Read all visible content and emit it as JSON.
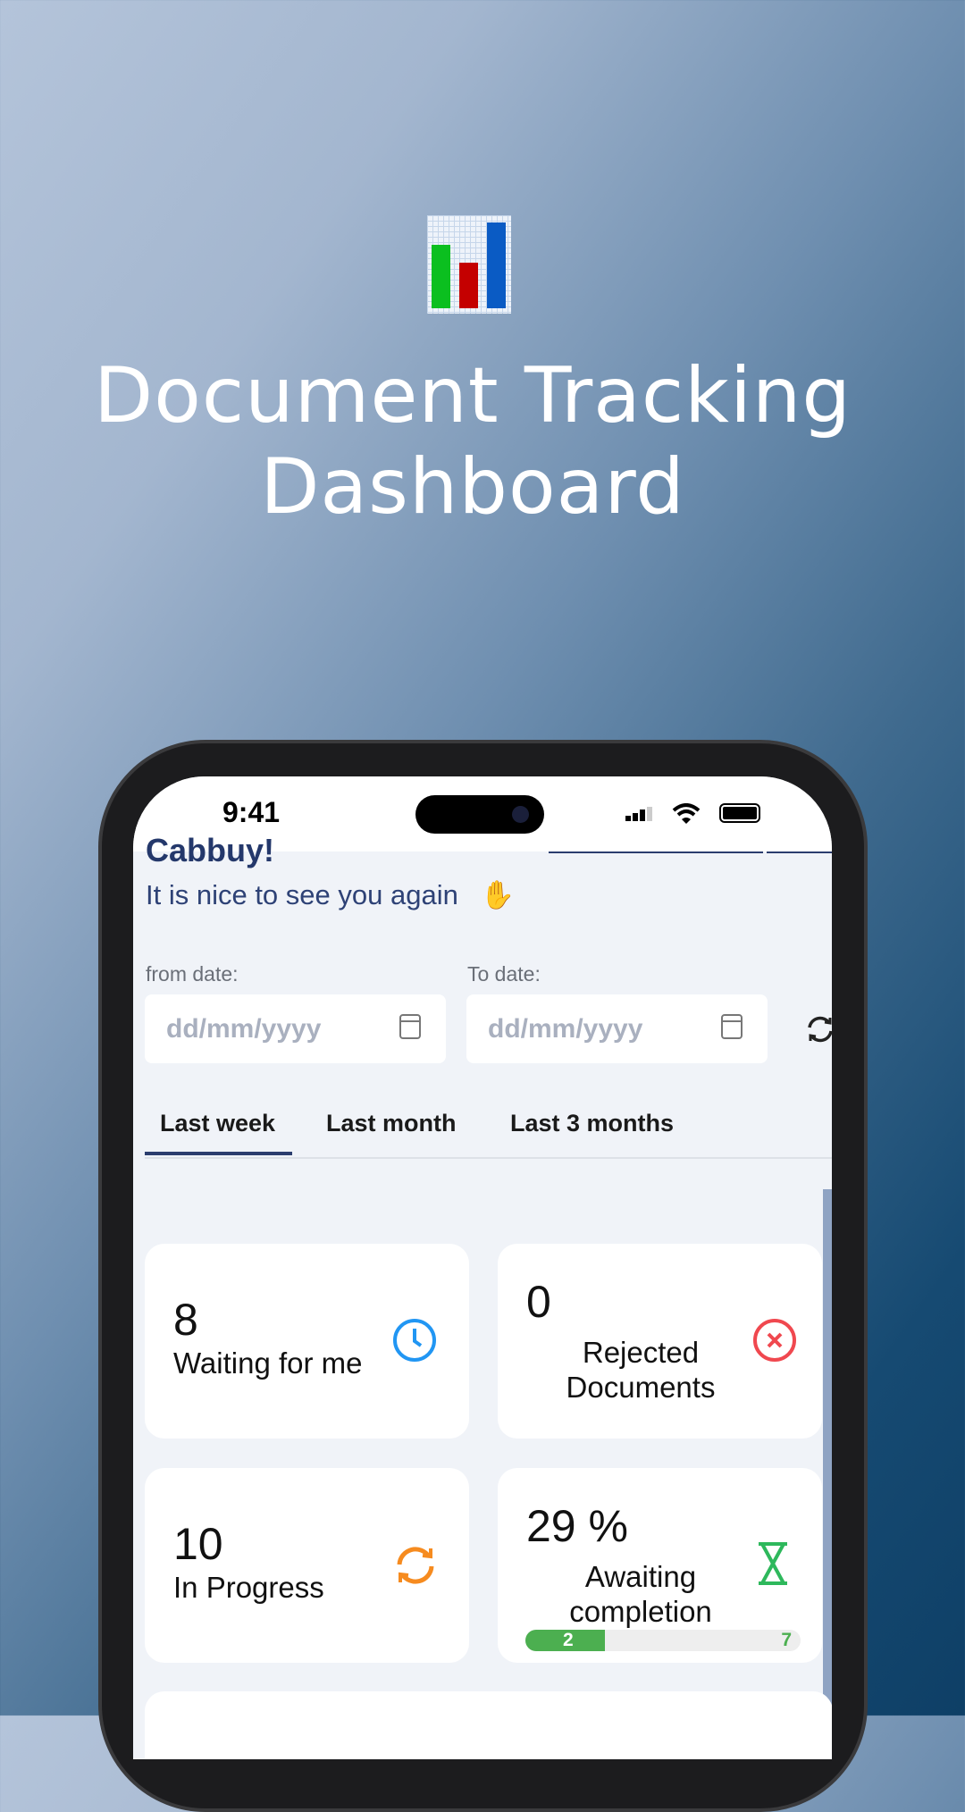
{
  "hero": {
    "title_line1": "Document Tracking",
    "title_line2": "Dashboard",
    "logo": "bar-chart-logo",
    "logo_colors": [
      "#00c020",
      "#c00000",
      "#0058c8"
    ]
  },
  "status_bar": {
    "time": "9:41"
  },
  "greeting": {
    "name_partial": "Cabbuy!",
    "subtitle": "It is nice to see you again",
    "icon": "waving-hand-icon"
  },
  "filters": {
    "from_label": "from date:",
    "from_placeholder": "dd/mm/yyyy",
    "to_label": "To date:",
    "to_placeholder": "dd/mm/yyyy"
  },
  "tabs": [
    {
      "label": "Last week",
      "active": true
    },
    {
      "label": "Last month",
      "active": false
    },
    {
      "label": "Last 3 months",
      "active": false
    }
  ],
  "cards": [
    {
      "value": "8",
      "label": "Waiting for me",
      "icon": "clock-icon",
      "color": "#2196f3"
    },
    {
      "value": "0",
      "label_line1": "Rejected",
      "label_line2": "Documents",
      "icon": "x-circle-icon",
      "color": "#f0484f"
    },
    {
      "value": "10",
      "label": "In Progress",
      "icon": "refresh-icon",
      "color": "#f68b1f"
    },
    {
      "value": "29 %",
      "label_line1": "Awaiting",
      "label_line2": "completion",
      "icon": "hourglass-icon",
      "color": "#2eb85c",
      "progress": {
        "done": "2",
        "total": "7",
        "fraction": 0.29
      }
    }
  ]
}
